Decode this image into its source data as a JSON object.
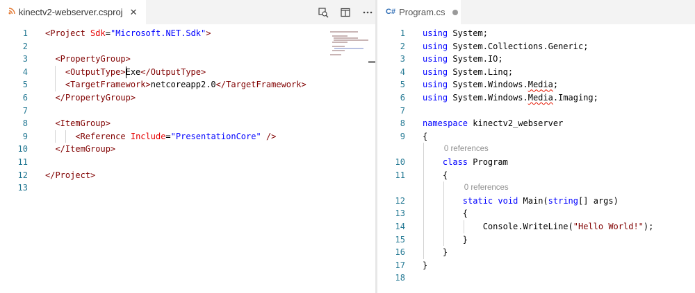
{
  "left_editor": {
    "tab": {
      "label": "kinectv2-webserver.csproj",
      "icon": "rss-file-icon",
      "icon_color": "#e37933",
      "close": "✕"
    },
    "lines": [
      [
        {
          "t": "<",
          "c": "tag"
        },
        {
          "t": "Project",
          "c": "tag"
        },
        {
          "t": " "
        },
        {
          "t": "Sdk",
          "c": "attr"
        },
        {
          "t": "="
        },
        {
          "t": "\"Microsoft.NET.Sdk\"",
          "c": "str"
        },
        {
          "t": ">",
          "c": "tag"
        }
      ],
      [],
      [
        {
          "t": "  "
        },
        {
          "t": "<PropertyGroup>",
          "c": "tag"
        }
      ],
      [
        {
          "t": "    "
        },
        {
          "t": "<OutputType>",
          "c": "tag"
        },
        {
          "t": "Exe"
        },
        {
          "t": "</OutputType>",
          "c": "tag"
        }
      ],
      [
        {
          "t": "    "
        },
        {
          "t": "<TargetFramework>",
          "c": "tag"
        },
        {
          "t": "netcoreapp2.0"
        },
        {
          "t": "</TargetFramework>",
          "c": "tag"
        }
      ],
      [
        {
          "t": "  "
        },
        {
          "t": "</PropertyGroup>",
          "c": "tag"
        }
      ],
      [],
      [
        {
          "t": "  "
        },
        {
          "t": "<ItemGroup>",
          "c": "tag"
        }
      ],
      [
        {
          "t": "      "
        },
        {
          "t": "<Reference",
          "c": "tag"
        },
        {
          "t": " "
        },
        {
          "t": "Include",
          "c": "attr"
        },
        {
          "t": "="
        },
        {
          "t": "\"PresentationCore\"",
          "c": "str"
        },
        {
          "t": " "
        },
        {
          "t": "/>",
          "c": "tag"
        }
      ],
      [
        {
          "t": "  "
        },
        {
          "t": "</ItemGroup>",
          "c": "tag"
        }
      ],
      [],
      [
        {
          "t": "</Project>",
          "c": "tag"
        }
      ],
      []
    ]
  },
  "right_editor": {
    "tab": {
      "label": "Program.cs",
      "icon": "csharp-file-icon",
      "icon_text": "C#",
      "icon_color": "#2f6db5"
    },
    "code_lens": "0 references",
    "lines": [
      [
        {
          "t": "using",
          "c": "kw"
        },
        {
          "t": " System;"
        }
      ],
      [
        {
          "t": "using",
          "c": "kw"
        },
        {
          "t": " System.Collections.Generic;"
        }
      ],
      [
        {
          "t": "using",
          "c": "kw"
        },
        {
          "t": " System.IO;"
        }
      ],
      [
        {
          "t": "using",
          "c": "kw"
        },
        {
          "t": " System.Linq;"
        }
      ],
      [
        {
          "t": "using",
          "c": "kw"
        },
        {
          "t": " System.Windows."
        },
        {
          "t": "Media",
          "c": "squig"
        },
        {
          "t": ";"
        }
      ],
      [
        {
          "t": "using",
          "c": "kw"
        },
        {
          "t": " System.Windows."
        },
        {
          "t": "Media",
          "c": "squig"
        },
        {
          "t": ".Imaging;"
        }
      ],
      [],
      [
        {
          "t": "namespace",
          "c": "kw"
        },
        {
          "t": " kinectv2_webserver"
        }
      ],
      [
        {
          "t": "{"
        }
      ],
      [
        {
          "t": "    "
        },
        {
          "t": "class",
          "c": "kw"
        },
        {
          "t": " Program"
        }
      ],
      [
        {
          "t": "    {"
        }
      ],
      [
        {
          "t": "        "
        },
        {
          "t": "static",
          "c": "kw"
        },
        {
          "t": " "
        },
        {
          "t": "void",
          "c": "kw"
        },
        {
          "t": " Main("
        },
        {
          "t": "string",
          "c": "kw"
        },
        {
          "t": "[] args)"
        }
      ],
      [
        {
          "t": "        {"
        }
      ],
      [
        {
          "t": "            Console.WriteLine("
        },
        {
          "t": "\"Hello World!\"",
          "c": "tag"
        },
        {
          "t": ");"
        }
      ],
      [
        {
          "t": "        }"
        }
      ],
      [
        {
          "t": "    }"
        }
      ],
      [
        {
          "t": "}"
        }
      ],
      []
    ]
  }
}
